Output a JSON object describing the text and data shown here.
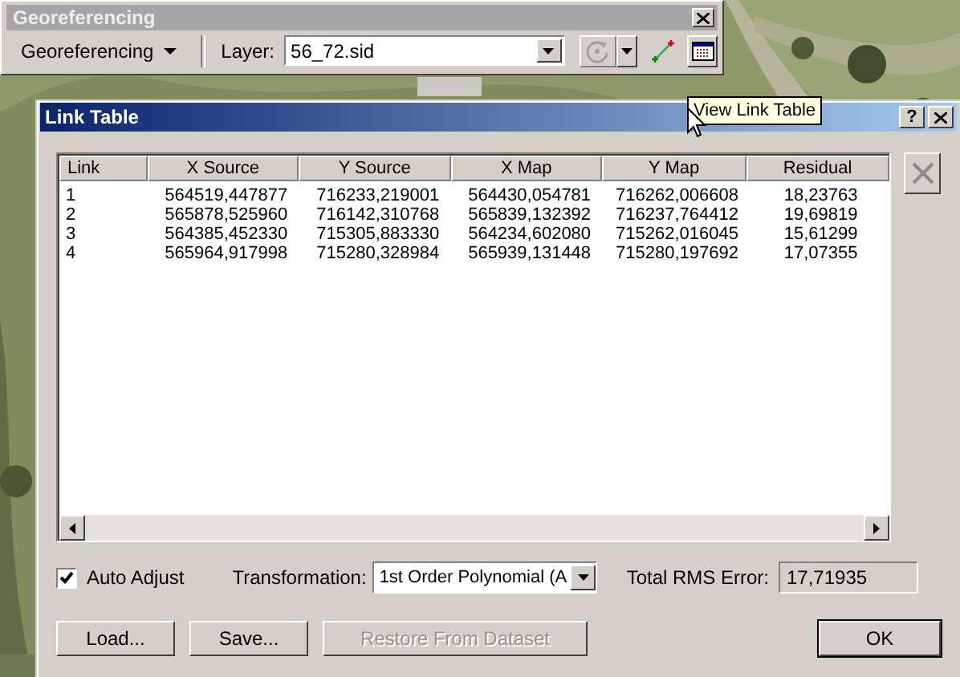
{
  "toolbar": {
    "title": "Georeferencing",
    "menu": "Georeferencing",
    "layer_label": "Layer:",
    "layer": "56_72.sid"
  },
  "tooltip": "View Link Table",
  "dialog": {
    "title": "Link Table",
    "help": "?",
    "table": {
      "columns": [
        "Link",
        "X Source",
        "Y Source",
        "X Map",
        "Y Map",
        "Residual"
      ],
      "rows": [
        [
          "1",
          "564519,447877",
          "716233,219001",
          "564430,054781",
          "716262,006608",
          "18,23763"
        ],
        [
          "2",
          "565878,525960",
          "716142,310768",
          "565839,132392",
          "716237,764412",
          "19,69819"
        ],
        [
          "3",
          "564385,452330",
          "715305,883330",
          "564234,602080",
          "715262,016045",
          "15,61299"
        ],
        [
          "4",
          "565964,917998",
          "715280,328984",
          "565939,131448",
          "715280,197692",
          "17,07355"
        ]
      ]
    },
    "auto_adjust": {
      "label": "Auto Adjust",
      "checked": true
    },
    "transformation": {
      "label": "Transformation:",
      "value": "1st Order Polynomial (A"
    },
    "rms": {
      "label": "Total RMS Error:",
      "value": "17,71935"
    },
    "buttons": [
      {
        "label": "Load...",
        "disabled": false,
        "kind": "left"
      },
      {
        "label": "Save...",
        "disabled": false,
        "kind": "left"
      },
      {
        "label": "Restore From Dataset",
        "disabled": true,
        "kind": "left"
      },
      {
        "label": "OK",
        "disabled": false,
        "kind": "right"
      }
    ]
  }
}
